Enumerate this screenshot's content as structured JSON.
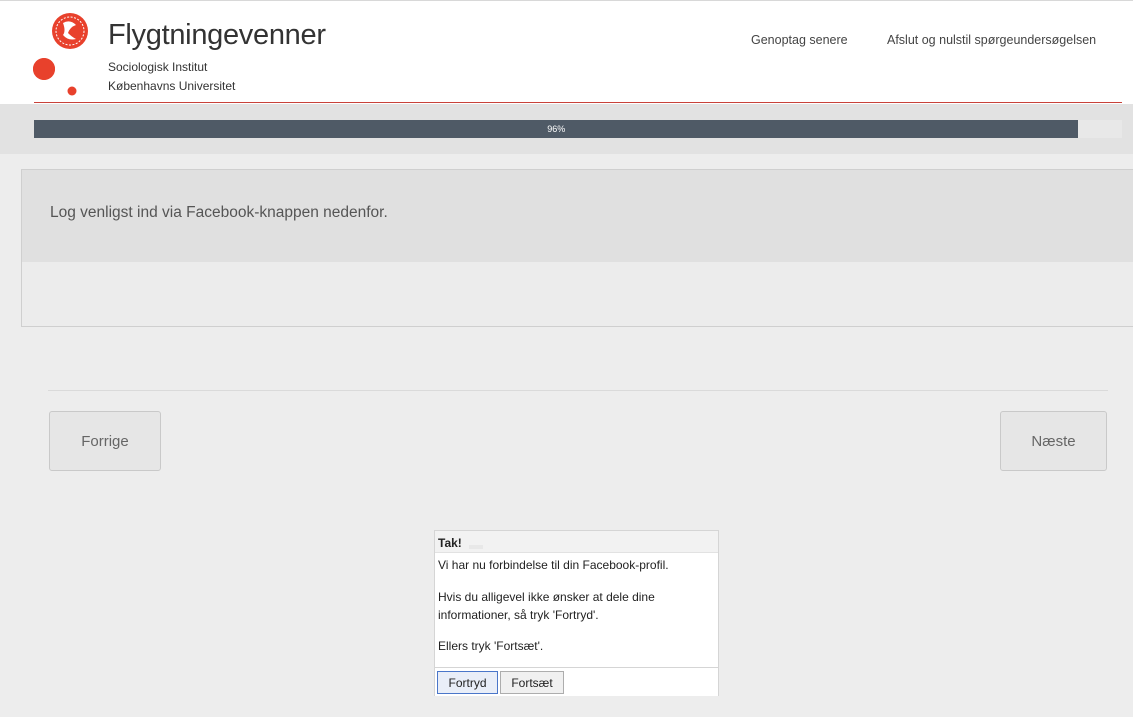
{
  "header": {
    "title": "Flygtningevenner",
    "subtitle_1": "Sociologisk Institut",
    "subtitle_2": "Københavns Universitet",
    "logo_icon": "university-seal-icon",
    "nav": {
      "resume_later": "Genoptag senere",
      "exit_reset": "Afslut og nulstil spørgeundersøgelsen"
    }
  },
  "progress": {
    "label": "96%",
    "value": 0.96,
    "color": "#4f5a66"
  },
  "question": {
    "text": "Log venligst ind via Facebook-knappen nedenfor."
  },
  "navigation": {
    "prev_label": "Forrige",
    "next_label": "Næste"
  },
  "dialog": {
    "title": "Tak!",
    "line_1": "Vi har nu forbindelse til din Facebook-profil.",
    "line_2": "Hvis du alligevel ikke ønsker at dele dine informationer, så tryk 'Fortryd'.",
    "line_3": "Ellers tryk 'Fortsæt'.",
    "cancel_label": "Fortryd",
    "continue_label": "Fortsæt"
  },
  "colors": {
    "brand_red": "#e8412c",
    "header_line": "#c8423a"
  }
}
